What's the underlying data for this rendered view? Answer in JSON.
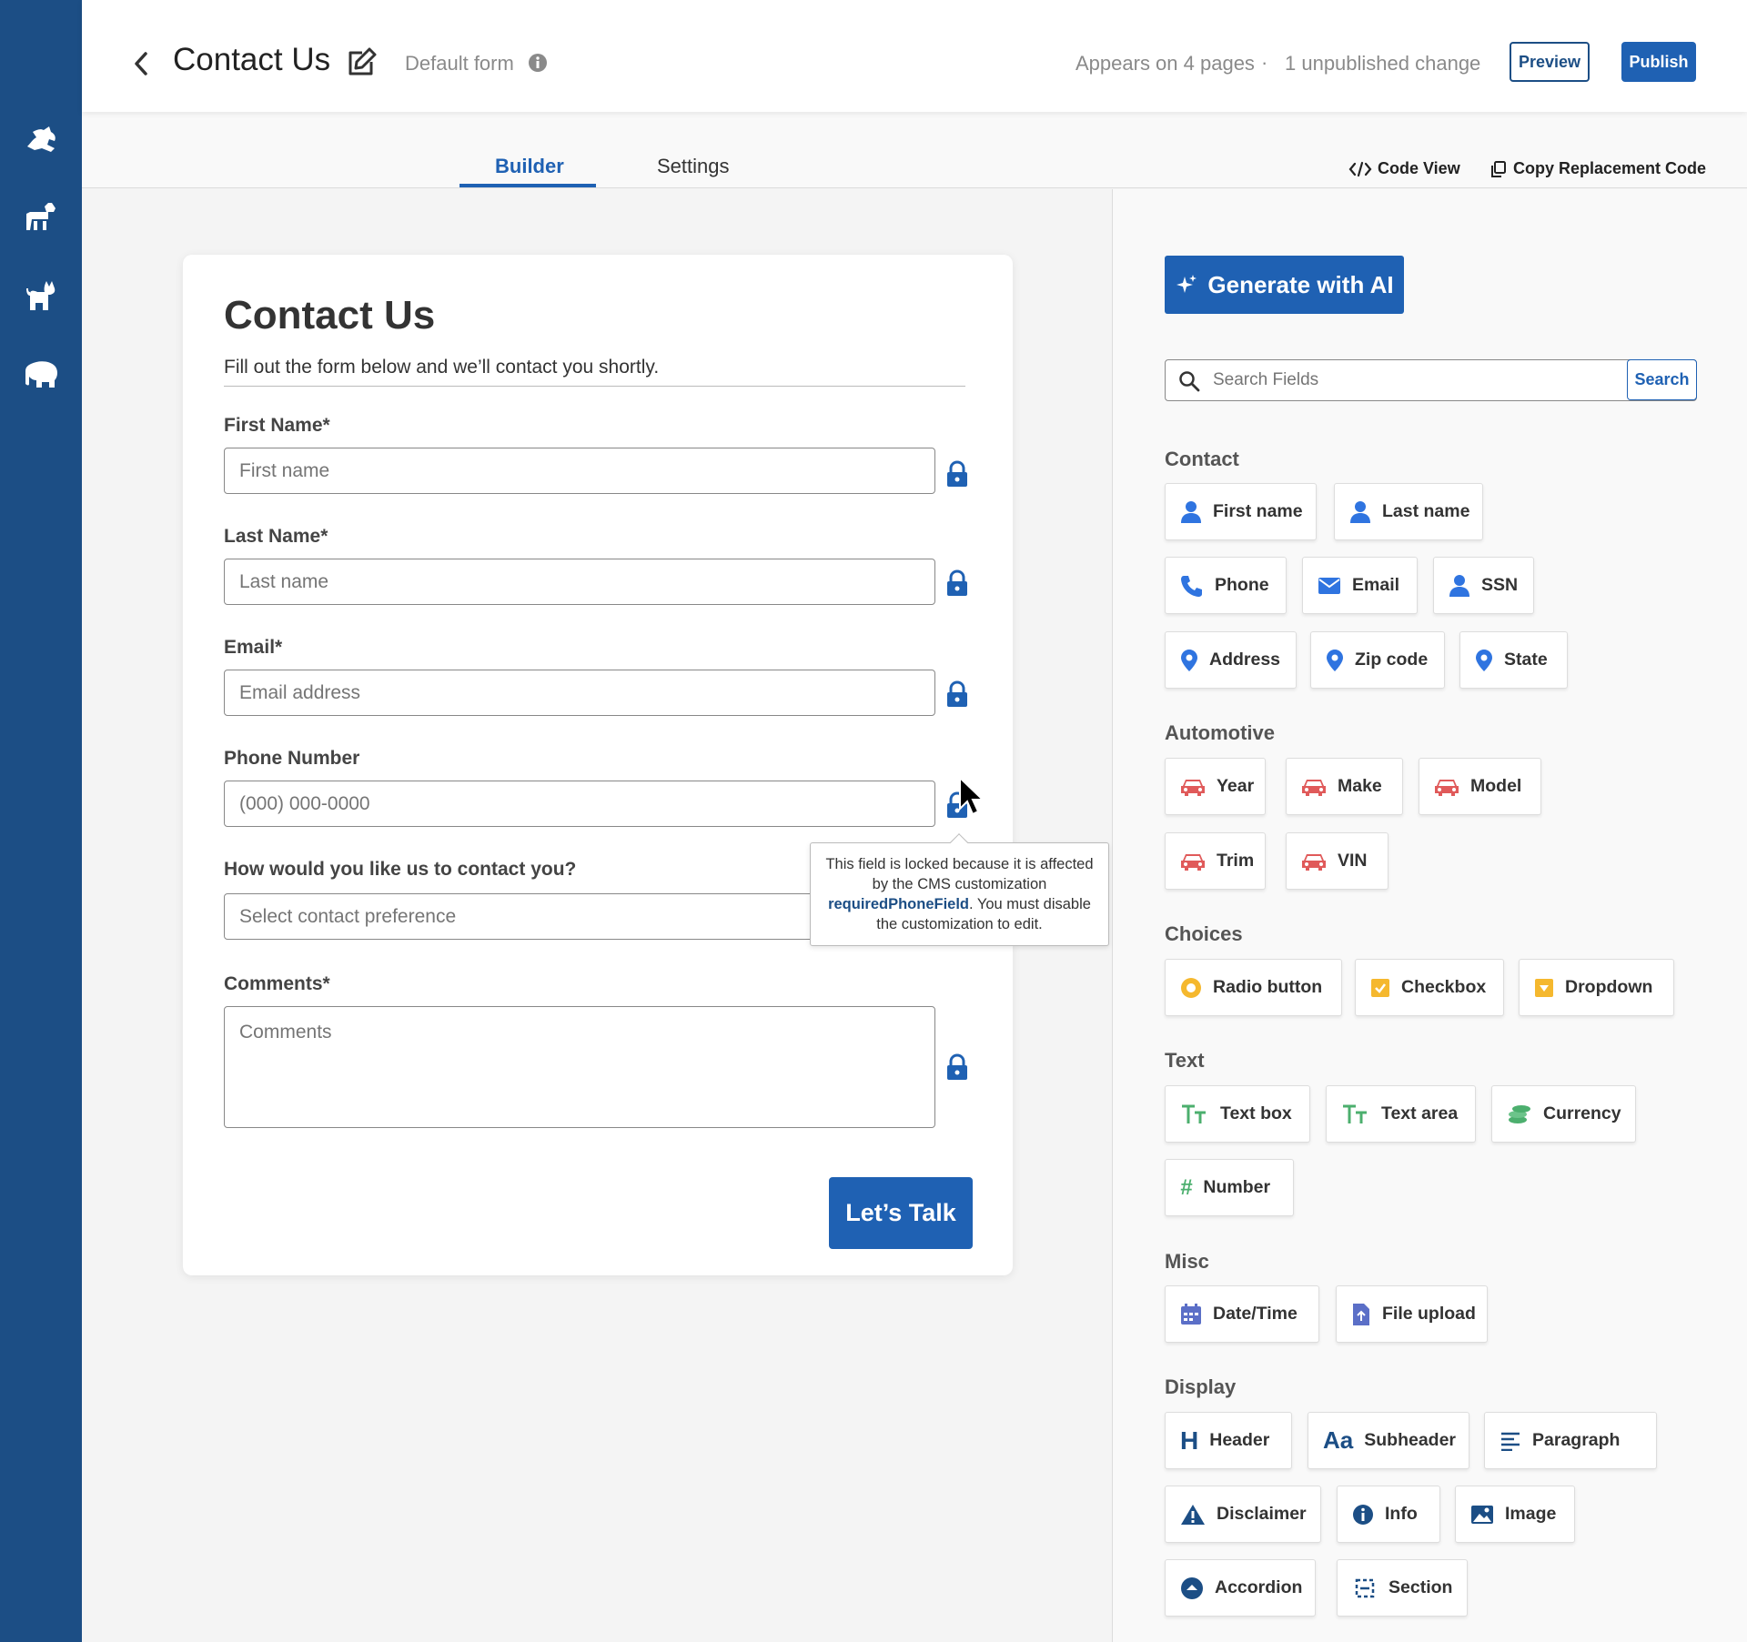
{
  "header": {
    "title": "Contact Us",
    "default_form": "Default form",
    "appears": "Appears on 4 pages",
    "separator": "·",
    "unpublished": "1 unpublished change",
    "preview_label": "Preview",
    "publish_label": "Publish"
  },
  "tabs": {
    "builder": "Builder",
    "settings": "Settings",
    "code_view": "Code View",
    "copy_code": "Copy Replacement Code"
  },
  "form": {
    "title": "Contact Us",
    "subtitle": "Fill out the form below and we’ll contact you shortly.",
    "fields": [
      {
        "label": "First Name*",
        "placeholder": "First name"
      },
      {
        "label": "Last Name*",
        "placeholder": "Last name"
      },
      {
        "label": "Email*",
        "placeholder": "Email address"
      },
      {
        "label": "Phone Number",
        "placeholder": "(000) 000-0000"
      },
      {
        "label": "How would you like us to contact you?",
        "placeholder": "Select contact preference"
      },
      {
        "label": "Comments*",
        "placeholder": "Comments"
      }
    ],
    "submit_label": "Let’s Talk"
  },
  "tooltip": {
    "pre": "This field is locked because it is affected by the CMS customization ",
    "keyword": "requiredPhoneField",
    "post": ". You must disable the customization to edit."
  },
  "panel": {
    "ai_label": "Generate with AI",
    "search_placeholder": "Search Fields",
    "search_button": "Search",
    "sections": {
      "contact": "Contact",
      "automotive": "Automotive",
      "choices": "Choices",
      "text": "Text",
      "misc": "Misc",
      "display": "Display"
    },
    "chips": {
      "first_name": "First name",
      "last_name": "Last name",
      "phone": "Phone",
      "email": "Email",
      "ssn": "SSN",
      "address": "Address",
      "zip": "Zip code",
      "state": "State",
      "year": "Year",
      "make": "Make",
      "model": "Model",
      "trim": "Trim",
      "vin": "VIN",
      "radio": "Radio button",
      "checkbox": "Checkbox",
      "dropdown": "Dropdown",
      "textbox": "Text box",
      "textarea": "Text area",
      "currency": "Currency",
      "number": "Number",
      "datetime": "Date/Time",
      "fileupload": "File upload",
      "header": "Header",
      "subheader": "Subheader",
      "paragraph": "Paragraph",
      "disclaimer": "Disclaimer",
      "info": "Info",
      "image": "Image",
      "accordion": "Accordion",
      "section": "Section"
    }
  },
  "colors": {
    "rail": "#1c4e85",
    "primary": "#1f61b3",
    "contact_icon": "#2f74e0",
    "auto_icon": "#e05a5a",
    "choice_icon": "#f5b82e",
    "text_icon": "#4caf6e",
    "misc_icon": "#5b6fc7"
  }
}
